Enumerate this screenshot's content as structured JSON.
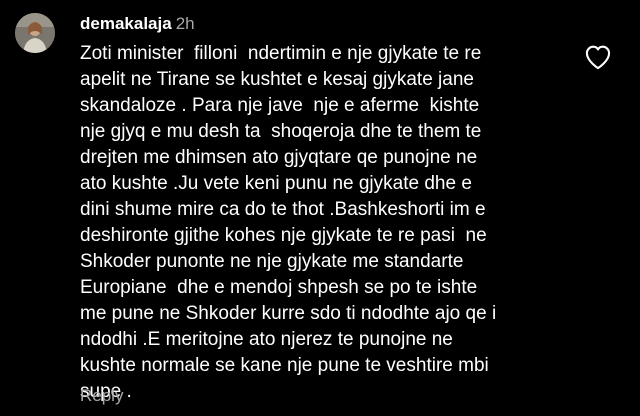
{
  "comment": {
    "username": "demakalaja",
    "time": "2h",
    "body_lines": [
      "Zoti minister  filloni  ndertimin e nje gjykate te re",
      "apelit ne Tirane se kushtet e kesaj gjykate jane",
      "skandaloze . Para nje jave  nje e aferme  kishte",
      "nje gjyq e mu desh ta  shoqeroja dhe te them te",
      "drejten me dhimsen ato gjyqtare qe punojne ne",
      "ato kushte .Ju vete keni punu ne gjykate dhe e",
      "dini shume mire ca do te thot .Bashkeshorti im e",
      "deshironte gjithe kohes nje gjykate te re pasi  ne",
      "Shkoder punonte ne nje gjykate me standarte",
      "Europiane  dhe e mendoj shpesh se po te ishte",
      "me pune ne Shkoder kurre sdo ti ndodhte ajo qe i",
      "ndodhi .E meritojne ato njerez te punojne ne",
      "kushte normale se kane nje pune te veshtire mbi",
      "supe ."
    ],
    "reply_label": "Reply",
    "like_icon": "heart-outline-icon",
    "avatar_icon": "profile-photo"
  },
  "colors": {
    "background": "#000000",
    "text": "#ffffff",
    "secondary_text": "#a8a8a8"
  }
}
